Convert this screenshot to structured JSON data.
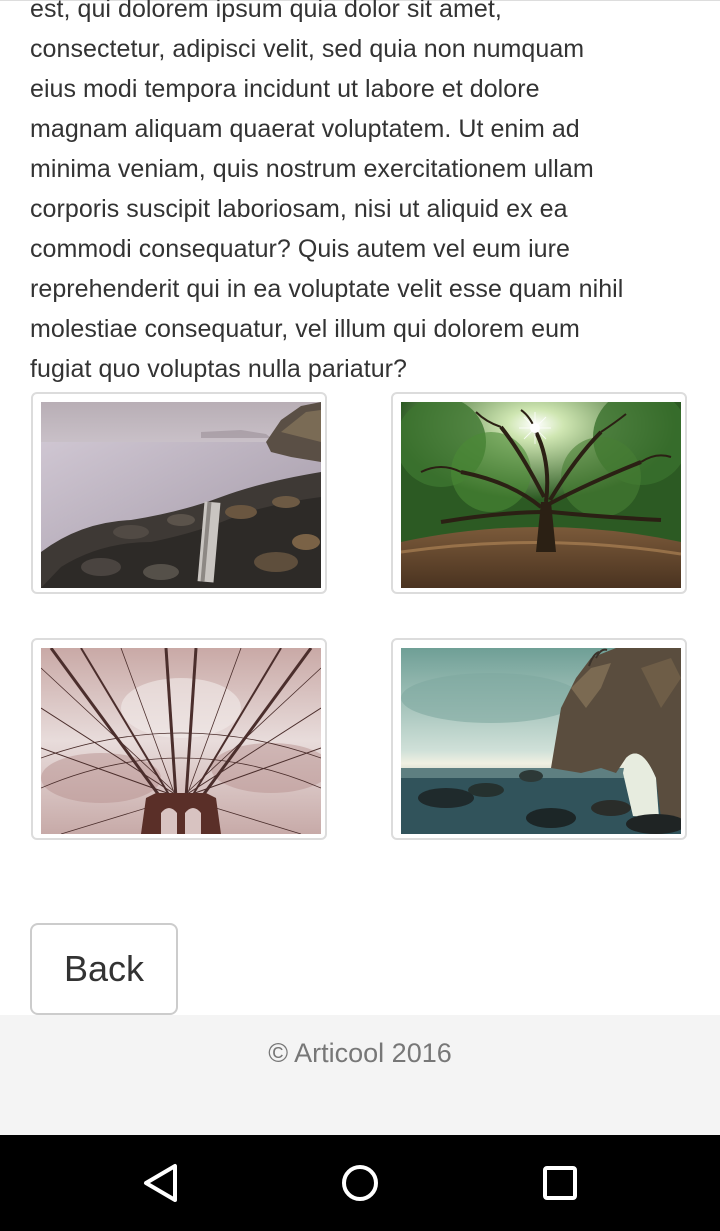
{
  "article": {
    "lines": [
      "est, qui dolorem ipsum quia dolor sit amet,",
      "consectetur, adipisci velit, sed quia non numquam",
      "eius modi tempora incidunt ut labore et dolore",
      "magnam aliquam quaerat voluptatem. Ut enim ad",
      "minima veniam, quis nostrum exercitationem ullam",
      "corporis suscipit laboriosam, nisi ut aliquid ex ea",
      "commodi consequatur? Quis autem vel eum iure",
      "reprehenderit qui in ea voluptate velit esse quam nihil",
      "molestiae consequatur, vel illum qui dolorem eum",
      "fugiat quo voluptas nulla pariatur?"
    ]
  },
  "gallery": {
    "images": [
      {
        "icon": "rocky-coast-photo"
      },
      {
        "icon": "oak-tree-photo"
      },
      {
        "icon": "bridge-cables-photo"
      },
      {
        "icon": "sea-arch-photo"
      }
    ]
  },
  "actions": {
    "back_label": "Back"
  },
  "footer": {
    "copyright": "© Articool 2016"
  },
  "system_nav": {
    "back_icon": "triangle-back-icon",
    "home_icon": "circle-home-icon",
    "recents_icon": "square-recents-icon"
  },
  "colors": {
    "text": "#333333",
    "footer_bg": "#f4f4f4",
    "footer_text": "#777777",
    "navbar_bg": "#000000",
    "thumb_border": "#dcdcdc"
  }
}
